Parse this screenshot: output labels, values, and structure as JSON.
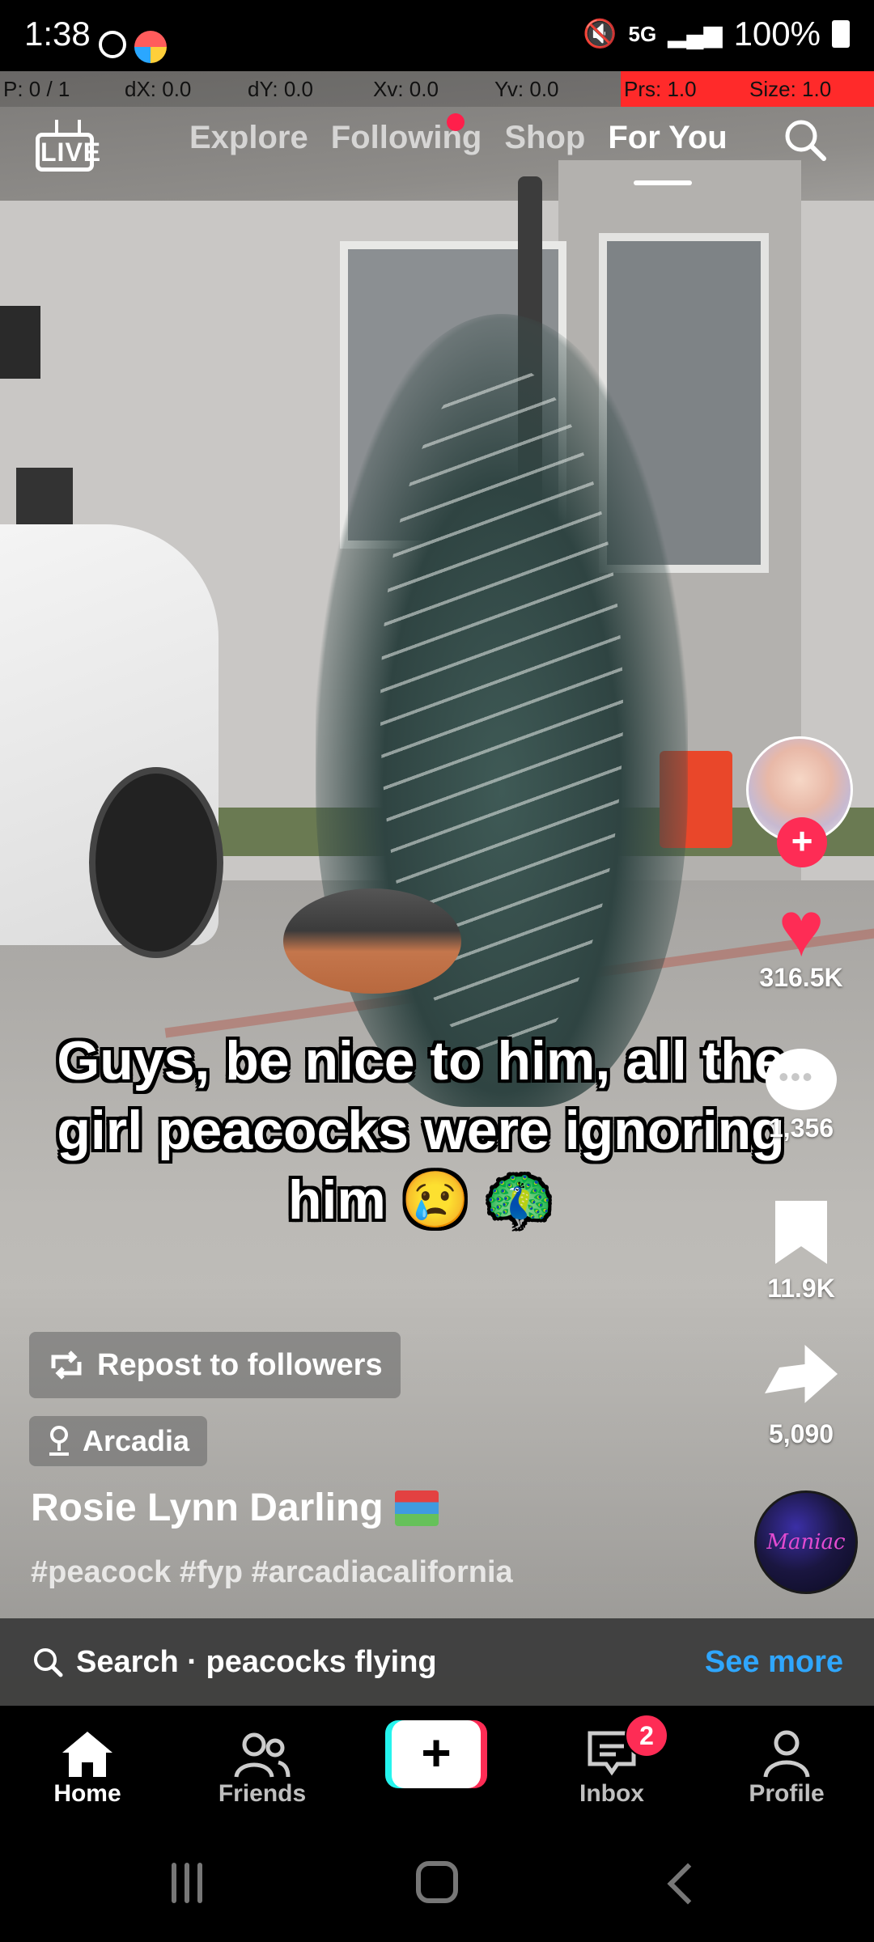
{
  "status_bar": {
    "time": "1:38",
    "network": "5G",
    "battery": "100%"
  },
  "debug_overlay": {
    "p": "P: 0 / 1",
    "dx": "dX: 0.0",
    "dy": "dY: 0.0",
    "xv": "Xv: 0.0",
    "yv": "Yv: 0.0",
    "prs": "Prs: 1.0",
    "size": "Size: 1.0"
  },
  "top_nav": {
    "live_label": "LIVE",
    "tabs": [
      "Explore",
      "Following",
      "Shop",
      "For You"
    ],
    "active_tab": "For You"
  },
  "caption": "Guys, be nice to him, all the girl peacocks were ignoring him 😢 🦚",
  "actions": {
    "likes": "316.5K",
    "comments": "1,356",
    "saves": "11.9K",
    "shares": "5,090"
  },
  "music_disc_text": "Maniac",
  "post": {
    "repost_label": "Repost to followers",
    "location": "Arcadia",
    "username": "Rosie Lynn Darling",
    "hashtags": "#peacock #fyp #arcadiacalifornia"
  },
  "search_strip": {
    "query": "Search · peacocks flying",
    "more": "See more"
  },
  "bottom_nav": {
    "home": "Home",
    "friends": "Friends",
    "inbox": "Inbox",
    "inbox_badge": "2",
    "profile": "Profile"
  },
  "colors": {
    "accent": "#fe2c55",
    "link": "#2fa6ff",
    "cyan": "#25f4ee"
  }
}
